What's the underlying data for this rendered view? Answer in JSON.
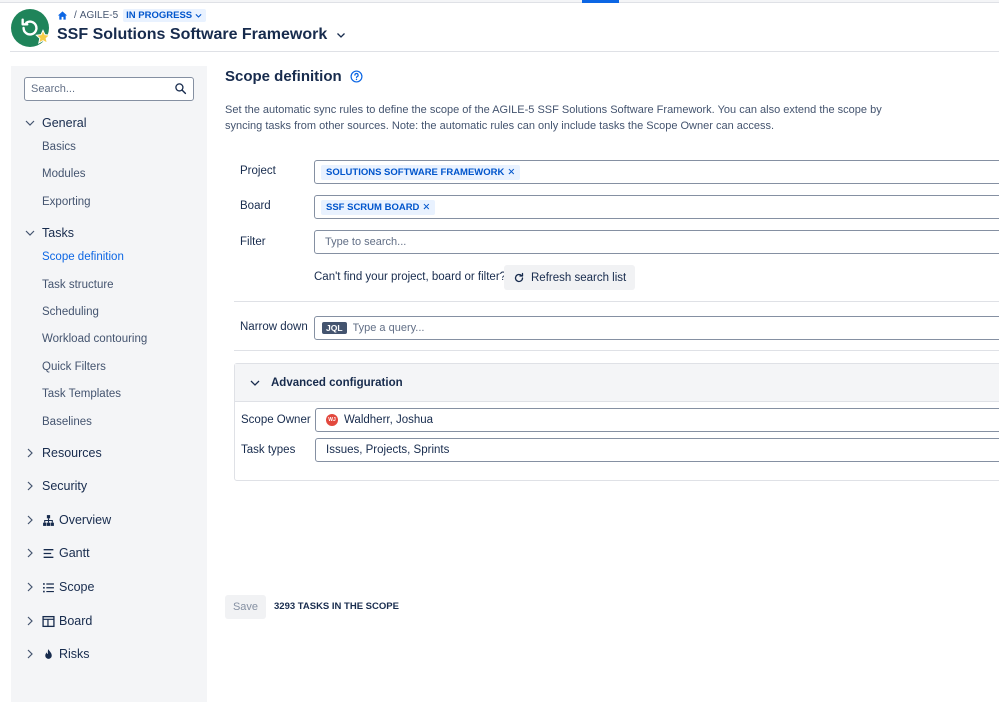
{
  "header": {
    "breadcrumb_project": "AGILE-5",
    "status": "IN PROGRESS",
    "title": "SSF Solutions Software Framework"
  },
  "sidebar": {
    "search_placeholder": "Search...",
    "groups": [
      {
        "label": "General",
        "expanded": true,
        "items": [
          "Basics",
          "Modules",
          "Exporting"
        ]
      },
      {
        "label": "Tasks",
        "expanded": true,
        "items": [
          "Scope definition",
          "Task structure",
          "Scheduling",
          "Workload contouring",
          "Quick Filters",
          "Task Templates",
          "Baselines"
        ]
      },
      {
        "label": "Resources",
        "expanded": false
      },
      {
        "label": "Security",
        "expanded": false
      },
      {
        "label": "Overview",
        "expanded": false,
        "icon": "hierarchy-icon"
      },
      {
        "label": "Gantt",
        "expanded": false,
        "icon": "gantt-icon"
      },
      {
        "label": "Scope",
        "expanded": false,
        "icon": "list-icon"
      },
      {
        "label": "Board",
        "expanded": false,
        "icon": "board-icon"
      },
      {
        "label": "Risks",
        "expanded": false,
        "icon": "fire-icon"
      }
    ],
    "active_item": "Scope definition"
  },
  "main": {
    "title": "Scope definition",
    "description": "Set the automatic sync rules to define the scope of the AGILE-5 SSF Solutions Software Framework. You can also extend the scope by syncing tasks from other sources. Note: the automatic rules can only include tasks the Scope Owner can access.",
    "project_label": "Project",
    "project_chip": "SOLUTIONS SOFTWARE FRAMEWORK",
    "board_label": "Board",
    "board_chip": "SSF SCRUM BOARD",
    "filter_label": "Filter",
    "filter_placeholder": "Type to search...",
    "cant_find": "Can't find your project, board or filter?",
    "refresh_label": "Refresh search list",
    "narrow_label": "Narrow down",
    "jql_badge": "JQL",
    "jql_placeholder": "Type a query...",
    "advanced": {
      "title": "Advanced configuration",
      "scope_owner_label": "Scope Owner",
      "scope_owner_value": "Waldherr, Joshua",
      "task_types_label": "Task types",
      "task_types_value": "Issues, Projects, Sprints"
    },
    "save_label": "Save",
    "task_count": "3293 TASKS IN THE SCOPE"
  },
  "colors": {
    "accent": "#0c66e4",
    "logo": "#1f845a",
    "chip_bg": "#e9f2ff",
    "chip_text": "#0055cc"
  }
}
